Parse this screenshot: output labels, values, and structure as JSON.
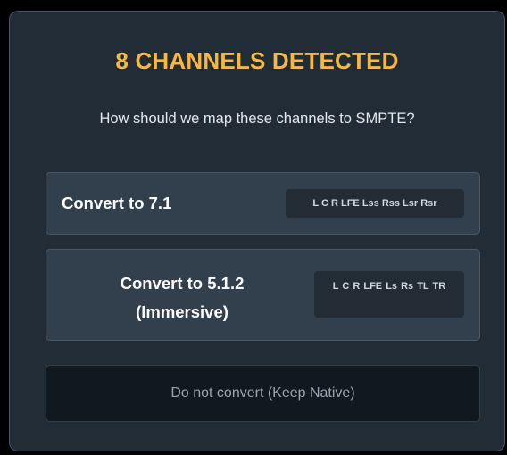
{
  "dialog": {
    "title": "8 CHANNELS DETECTED",
    "prompt": "How should we map these channels to SMPTE?",
    "options": [
      {
        "label": "Convert to 7.1",
        "channels": "L C R LFE Lss Rss Lsr Rsr"
      },
      {
        "label": "Convert to 5.1.2 (Immersive)",
        "channels": "L C R LFE Ls Rs TL TR"
      }
    ],
    "keep_native_label": "Do not convert (Keep Native)"
  },
  "colors": {
    "title_accent": "#f6b83f",
    "dialog_background": "#222c36",
    "option_background": "#323f4c",
    "chip_background": "#232b35",
    "keep_native_background": "#12181f"
  }
}
